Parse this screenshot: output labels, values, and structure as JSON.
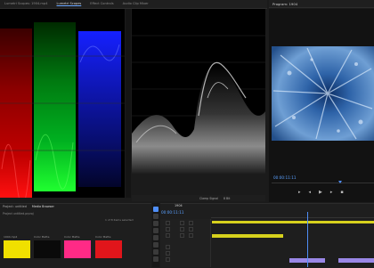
{
  "top_tabs": [
    {
      "label": "Lumetri Scopes: 1904.mp4"
    },
    {
      "label": "Lumetri Scopes",
      "active": true
    },
    {
      "label": "Effect Controls"
    },
    {
      "label": "Audio Clip Mixer"
    }
  ],
  "program": {
    "title": "Program: 1904",
    "timecode": "00:00:11:11"
  },
  "scopes": {
    "bottom_labels": [
      "Clamp Signal",
      "8 Bit"
    ]
  },
  "project": {
    "tabs": [
      {
        "label": "Project: untitled"
      },
      {
        "label": "Media Browser",
        "active": true
      }
    ],
    "name": "Project untitled.prproj",
    "item_count": "1 of 8 items selected",
    "clips": [
      {
        "label": "1904.mp4",
        "color": "#f0e000"
      },
      {
        "label": "Color Matte",
        "color": "#0a0a0a"
      },
      {
        "label": "Color Matte",
        "color": "#ff2a86"
      },
      {
        "label": "Color Matte",
        "color": "#e1151b"
      }
    ]
  },
  "timeline": {
    "tab_label": "1904",
    "timecode": "00:00:11:11"
  },
  "colors": {
    "accent": "#4f8ef7",
    "timecode": "#5aa0ff",
    "clip_yellow": "#d7d11d",
    "clip_purple": "#9a87e6"
  }
}
